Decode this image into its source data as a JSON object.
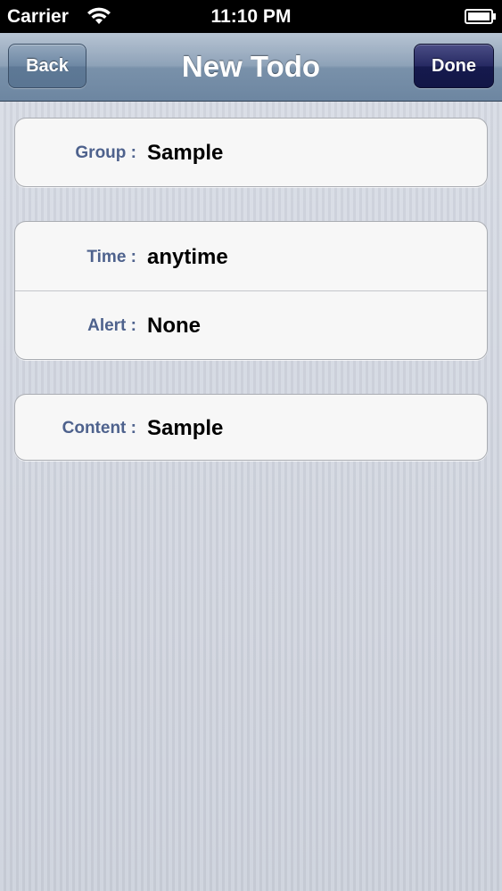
{
  "status_bar": {
    "carrier": "Carrier",
    "time": "11:10 PM",
    "wifi_icon": "wifi-icon",
    "battery_icon": "battery-icon"
  },
  "nav_bar": {
    "title": "New Todo",
    "back_label": "Back",
    "done_label": "Done"
  },
  "groups": [
    {
      "rows": [
        {
          "label": "Group :",
          "value": "Sample"
        }
      ]
    },
    {
      "rows": [
        {
          "label": "Time :",
          "value": "anytime"
        },
        {
          "label": "Alert :",
          "value": "None"
        }
      ]
    },
    {
      "rows": [
        {
          "label": "Content :",
          "value": "Sample"
        }
      ]
    }
  ],
  "colors": {
    "label_text": "#4e628d",
    "nav_bar": "#7991aa",
    "done_button": "#161a4e",
    "background": "#cfd4de"
  }
}
